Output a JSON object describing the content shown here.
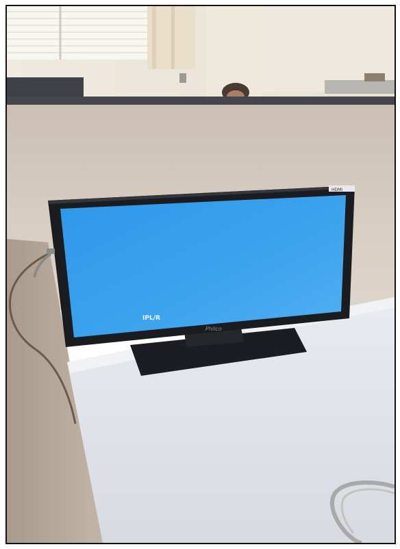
{
  "photo": {
    "monitor_brand": "Philco",
    "screen_overlay": "IPL/R",
    "sticker": "HDMI"
  },
  "colors": {
    "screen_blue": "#3aa0ec",
    "bezel": "#1b1c20",
    "partition": "#d4c8bd",
    "desk": "#e2e4ea",
    "window_light": "#f6f3ec"
  }
}
